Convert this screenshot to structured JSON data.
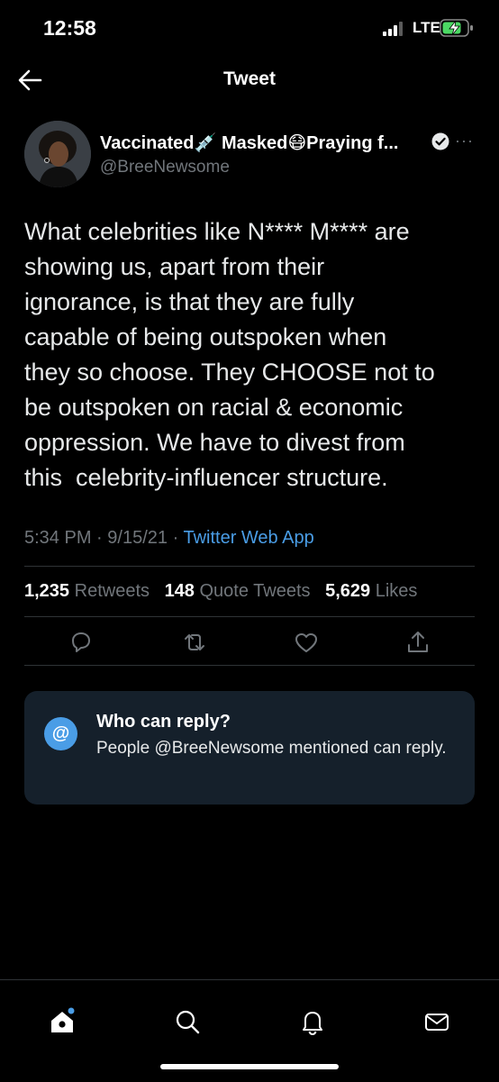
{
  "status_bar": {
    "time": "12:58",
    "network": "LTE"
  },
  "nav": {
    "title": "Tweet",
    "back_icon": "arrow-left-icon"
  },
  "tweet": {
    "author_name": "Vaccinated💉 Masked😷Praying f...",
    "author_handle": "@BreeNewsome",
    "more_label": "···",
    "text_lines": [
      "What celebrities like N**** M**** are",
      "showing us, apart from their",
      "ignorance, is that they are fully",
      "capable of being outspoken when",
      "they so choose. They CHOOSE not to",
      "be outspoken on racial & economic",
      "oppression. We have to divest from",
      "this  celebrity-influencer structure."
    ],
    "time": "5:34 PM",
    "date": "9/15/21",
    "separator": "·",
    "source": "Twitter Web App"
  },
  "stats": {
    "retweets_count": "1,235",
    "retweets_label": "Retweets",
    "quotes_count": "148",
    "quotes_label": "Quote Tweets",
    "likes_count": "5,629",
    "likes_label": "Likes"
  },
  "actions": [
    "reply-icon",
    "retweet-icon",
    "like-icon",
    "share-icon"
  ],
  "reply_card": {
    "badge": "@",
    "title": "Who can reply?",
    "body": "People @BreeNewsome mentioned can reply."
  },
  "tab_bar": [
    "home-icon",
    "search-icon",
    "notifications-icon",
    "messages-icon"
  ],
  "colors": {
    "accent": "#4a9de6",
    "background": "#000000",
    "card": "#15202b",
    "muted": "#71767b"
  }
}
